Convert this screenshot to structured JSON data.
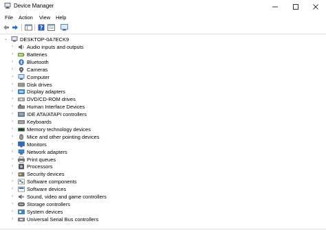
{
  "window": {
    "title": "Device Manager"
  },
  "menu": [
    {
      "label": "File"
    },
    {
      "label": "Action"
    },
    {
      "label": "View"
    },
    {
      "label": "Help"
    }
  ],
  "tree": {
    "root": "DESKTOP-0A7ECK9",
    "items": [
      {
        "label": "Audio inputs and outputs",
        "icon": "speaker-icon"
      },
      {
        "label": "Batteries",
        "icon": "battery-icon"
      },
      {
        "label": "Bluetooth",
        "icon": "bluetooth-icon"
      },
      {
        "label": "Cameras",
        "icon": "camera-icon"
      },
      {
        "label": "Computer",
        "icon": "computer-icon"
      },
      {
        "label": "Disk drives",
        "icon": "disk-drive-icon"
      },
      {
        "label": "Display adapters",
        "icon": "display-adapter-icon"
      },
      {
        "label": "DVD/CD-ROM drives",
        "icon": "optical-drive-icon"
      },
      {
        "label": "Human Interface Devices",
        "icon": "hid-icon"
      },
      {
        "label": "IDE ATA/ATAPI controllers",
        "icon": "ide-controller-icon"
      },
      {
        "label": "Keyboards",
        "icon": "keyboard-icon"
      },
      {
        "label": "Memory technology devices",
        "icon": "memory-icon"
      },
      {
        "label": "Mice and other pointing devices",
        "icon": "mouse-icon"
      },
      {
        "label": "Monitors",
        "icon": "monitor-icon"
      },
      {
        "label": "Network adapters",
        "icon": "network-adapter-icon"
      },
      {
        "label": "Print queues",
        "icon": "printer-icon"
      },
      {
        "label": "Processors",
        "icon": "processor-icon"
      },
      {
        "label": "Security devices",
        "icon": "security-icon"
      },
      {
        "label": "Software components",
        "icon": "software-component-icon"
      },
      {
        "label": "Software devices",
        "icon": "software-device-icon"
      },
      {
        "label": "Sound, video and game controllers",
        "icon": "sound-controller-icon"
      },
      {
        "label": "Storage controllers",
        "icon": "storage-controller-icon"
      },
      {
        "label": "System devices",
        "icon": "system-device-icon"
      },
      {
        "label": "Universal Serial Bus controllers",
        "icon": "usb-icon"
      }
    ]
  },
  "colors": {
    "accent": "#2b6cc4",
    "icon_gray": "#6a6a6a"
  }
}
